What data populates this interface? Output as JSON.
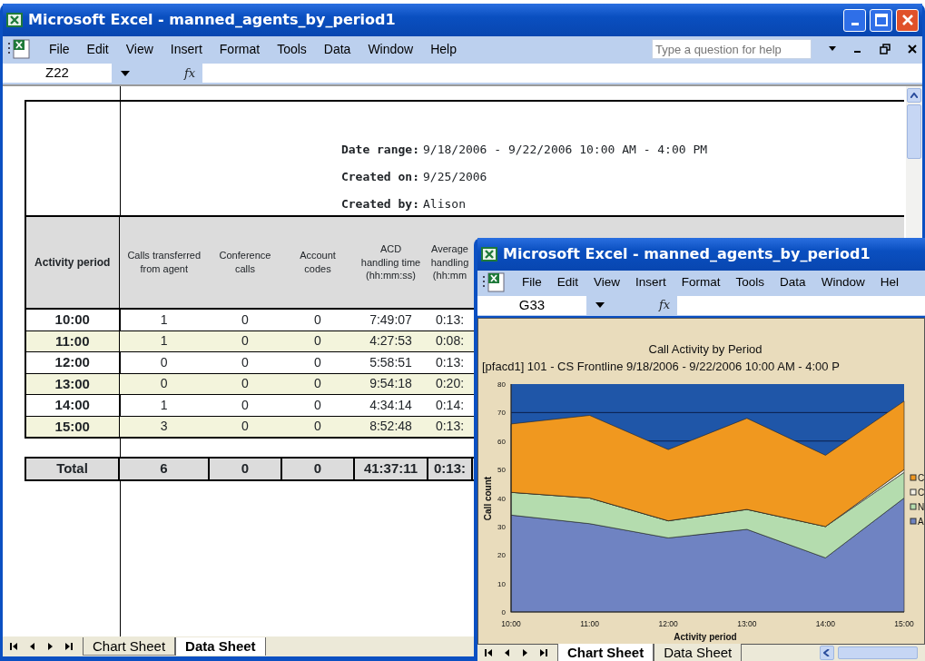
{
  "back_window": {
    "title": "Microsoft Excel - manned_agents_by_period1",
    "menu": [
      "File",
      "Edit",
      "View",
      "Insert",
      "Format",
      "Tools",
      "Data",
      "Window",
      "Help"
    ],
    "help_box": {
      "placeholder": "Type a question for help"
    },
    "name_box": "Z22",
    "formula_label": "fx",
    "report": [
      {
        "label": "Date range:",
        "value": "9/18/2006 - 9/22/2006 10:00 AM - 4:00 PM"
      },
      {
        "label": "Created on:",
        "value": "9/25/2006"
      },
      {
        "label": "Created by:",
        "value": "Alison"
      }
    ],
    "table": {
      "columns": [
        "Activity period",
        "Calls transferred from agent",
        "Conference calls",
        "Account codes",
        "ACD\nhandling time\n(hh:mm:ss)",
        "Average\nhandling\n(hh:mm"
      ],
      "rows": [
        [
          "10:00",
          "1",
          "0",
          "0",
          "7:49:07",
          "0:13:"
        ],
        [
          "11:00",
          "1",
          "0",
          "0",
          "4:27:53",
          "0:08:"
        ],
        [
          "12:00",
          "0",
          "0",
          "0",
          "5:58:51",
          "0:13:"
        ],
        [
          "13:00",
          "0",
          "0",
          "0",
          "9:54:18",
          "0:20:"
        ],
        [
          "14:00",
          "1",
          "0",
          "0",
          "4:34:14",
          "0:14:"
        ],
        [
          "15:00",
          "3",
          "0",
          "0",
          "8:52:48",
          "0:13:"
        ]
      ],
      "total": [
        "Total",
        "6",
        "0",
        "0",
        "41:37:11",
        "0:13:"
      ]
    },
    "sheet_tabs": [
      {
        "label": "Chart Sheet",
        "selected": false
      },
      {
        "label": "Data Sheet",
        "selected": true
      }
    ]
  },
  "front_window": {
    "title": "Microsoft Excel - manned_agents_by_period1",
    "menu": [
      "File",
      "Edit",
      "View",
      "Insert",
      "Format",
      "Tools",
      "Data",
      "Window",
      "Hel"
    ],
    "name_box": "G33",
    "formula_label": "fx",
    "chart": {
      "title": "Call Activity by Period",
      "subtitle": "[pfacd1] 101 - CS Frontline 9/18/2006 - 9/22/2006 10:00 AM - 4:00 P",
      "chart_data": {
        "type": "area",
        "stacked": true,
        "xlabel": "Activity period",
        "ylabel": "Call count",
        "categories": [
          "10:00",
          "11:00",
          "12:00",
          "13:00",
          "14:00",
          "15:00"
        ],
        "series": [
          {
            "name": "C",
            "color": "#f0981f",
            "values": [
              24,
              29,
              25,
              32,
              25,
              24
            ]
          },
          {
            "name": "C",
            "color": "#f4f1e6",
            "values": [
              0,
              0,
              0,
              0,
              0,
              1
            ]
          },
          {
            "name": "N",
            "color": "#b4dcae",
            "values": [
              8,
              9,
              6,
              7,
              11,
              9
            ]
          },
          {
            "name": "A",
            "color": "#6f83c2",
            "values": [
              34,
              31,
              26,
              29,
              19,
              40
            ]
          }
        ],
        "ylim": [
          0,
          80
        ],
        "yticks": [
          0,
          10,
          20,
          30,
          40,
          50,
          60,
          70,
          80
        ],
        "grid": {
          "y": true
        },
        "legend": true
      }
    },
    "sheet_tabs": [
      {
        "label": "Chart Sheet",
        "selected": true
      },
      {
        "label": "Data Sheet",
        "selected": false
      }
    ]
  }
}
